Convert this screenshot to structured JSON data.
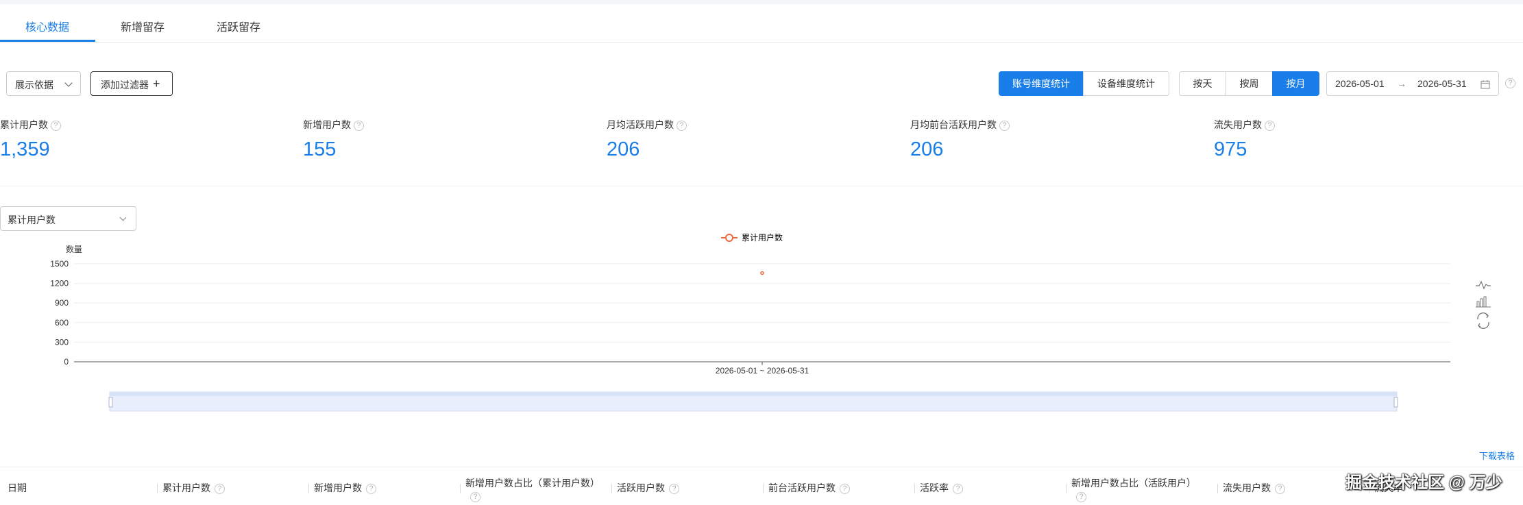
{
  "tabs": [
    {
      "label": "核心数据",
      "active": true
    },
    {
      "label": "新增留存",
      "active": false
    },
    {
      "label": "活跃留存",
      "active": false
    }
  ],
  "toolbar": {
    "basis_label": "展示依据",
    "filter_label": "添加过滤器",
    "stat_mode": [
      "账号维度统计",
      "设备维度统计"
    ],
    "granularity": [
      "按天",
      "按周",
      "按月"
    ],
    "date_start": "2026-05-01",
    "date_sep": "→",
    "date_end": "2026-05-31"
  },
  "stats": [
    {
      "label": "累计用户数",
      "value": "1,359"
    },
    {
      "label": "新增用户数",
      "value": "155"
    },
    {
      "label": "月均活跃用户数",
      "value": "206"
    },
    {
      "label": "月均前台活跃用户数",
      "value": "206"
    },
    {
      "label": "流失用户数",
      "value": "975"
    }
  ],
  "metric_select": "累计用户数",
  "download_label": "下载表格",
  "table_headers": [
    "日期",
    "累计用户数",
    "新增用户数",
    "新增用户数占比（累计用户数）",
    "活跃用户数",
    "前台活跃用户数",
    "活跃率",
    "新增用户数占比（活跃用户）",
    "流失用户数",
    "流失率"
  ],
  "watermark": "掘金技术社区 @ 万少",
  "colors": {
    "accent": "#1a7ee8",
    "series": "#ee6a3e"
  },
  "chart_data": {
    "type": "line",
    "ylabel": "数量",
    "categories": [
      "2026-05-01 ~ 2026-05-31"
    ],
    "series": [
      {
        "name": "累计用户数",
        "values": [
          1359
        ]
      }
    ],
    "ylim": [
      0,
      1500
    ],
    "yticks": [
      0,
      300,
      600,
      900,
      1200,
      1500
    ],
    "grid": true,
    "legend": "top-center"
  }
}
